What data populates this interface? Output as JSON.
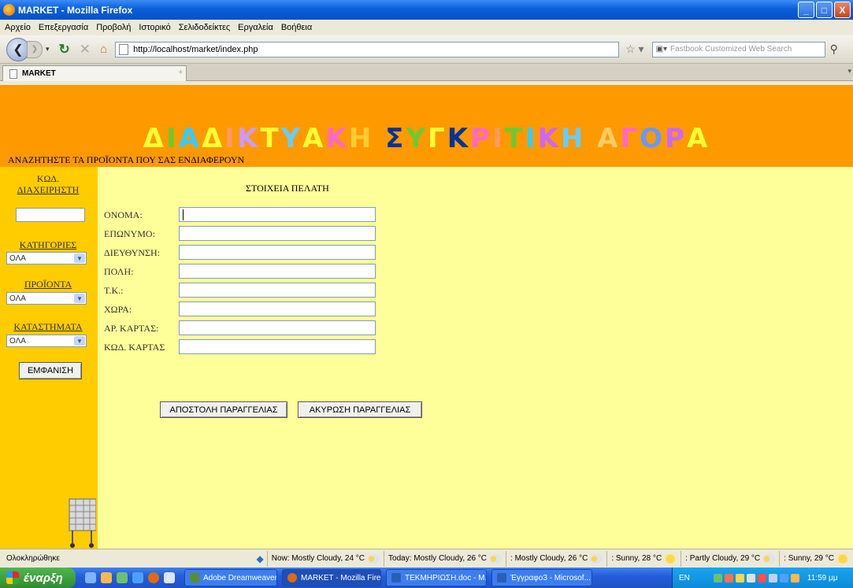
{
  "window": {
    "title": "MARKET - Mozilla Firefox",
    "controls": [
      "_",
      "□",
      "X"
    ]
  },
  "menu": [
    "Αρχείο",
    "Επεξεργασία",
    "Προβολή",
    "Ιστορικό",
    "Σελιδοδείκτες",
    "Εργαλεία",
    "Βοήθεια"
  ],
  "nav": {
    "url": "http://localhost/market/index.php",
    "search_placeholder": "Fastbook Customized Web Search"
  },
  "tab": {
    "label": "MARKET",
    "new_tab": "+"
  },
  "page": {
    "banner_letters": [
      {
        "ch": "Δ",
        "color": "#ffff33"
      },
      {
        "ch": "Ι",
        "color": "#66cc33"
      },
      {
        "ch": "Α",
        "color": "#33ccff"
      },
      {
        "ch": "Δ",
        "color": "#ffff33"
      },
      {
        "ch": "Ι",
        "color": "#ff9966"
      },
      {
        "ch": "Κ",
        "color": "#cc99ff"
      },
      {
        "ch": "Τ",
        "color": "#ffff33"
      },
      {
        "ch": "Υ",
        "color": "#66ccff"
      },
      {
        "ch": "Α",
        "color": "#ffff33"
      },
      {
        "ch": "Κ",
        "color": "#ff66cc"
      },
      {
        "ch": "Η",
        "color": "#ffcc33"
      },
      {
        "ch": " ",
        "color": "#ffffff"
      },
      {
        "ch": "Σ",
        "color": "#003399"
      },
      {
        "ch": "Υ",
        "color": "#66cc33"
      },
      {
        "ch": "Γ",
        "color": "#ffff33"
      },
      {
        "ch": "Κ",
        "color": "#003399"
      },
      {
        "ch": "Ρ",
        "color": "#ff66cc"
      },
      {
        "ch": "Ι",
        "color": "#ff9966"
      },
      {
        "ch": "Τ",
        "color": "#66cc33"
      },
      {
        "ch": "Ι",
        "color": "#33ccff"
      },
      {
        "ch": "Κ",
        "color": "#cc66ff"
      },
      {
        "ch": "Η",
        "color": "#66ccff"
      },
      {
        "ch": " ",
        "color": "#ffffff"
      },
      {
        "ch": "Α",
        "color": "#ffcc66"
      },
      {
        "ch": "Γ",
        "color": "#ff66cc"
      },
      {
        "ch": "Ο",
        "color": "#6699ff"
      },
      {
        "ch": "Ρ",
        "color": "#cc66ff"
      },
      {
        "ch": "Α",
        "color": "#ffff33"
      }
    ],
    "subheading": "ΑΝΑΖΗΤΗΣΤΕ ΤΑ ΠΡΟΪΟΝΤΑ ΠΟΥ ΣΑΣ ΕΝΔΙΑΦΕΡΟΥΝ",
    "sidebar": {
      "admin_code_label_1": "ΚΩΔ.",
      "admin_code_label_2": "ΔΙΑΧΕΙΡΗΣΤΗ",
      "categories_label": "ΚΑΤΗΓΟΡΙΕΣ",
      "categories_value": "ΟΛΑ",
      "products_label": "ΠΡΟΪΟΝΤΑ",
      "products_value": "ΟΛΑ",
      "stores_label": "ΚΑΤΑΣΤΗΜΑΤΑ",
      "stores_value": "ΟΛΑ",
      "show_button": "ΕΜΦΑΝΙΣΗ"
    },
    "form": {
      "title": "ΣΤΟΙΧΕΙΑ ΠΕΛΑΤΗ",
      "fields": [
        "ΟΝΟΜΑ:",
        "ΕΠΩΝΥΜΟ:",
        "ΔΙΕΥΘΥΝΣΗ:",
        "ΠΟΛΗ:",
        "Τ.Κ.:",
        "ΧΩΡΑ:",
        "ΑΡ. ΚΑΡΤΑΣ:",
        "ΚΩΔ. ΚΑΡΤΑΣ"
      ],
      "submit_button": "ΑΠΟΣΤΟΛΗ ΠΑΡΑΓΓΕΛΙΑΣ",
      "cancel_button": "ΑΚΥΡΩΣΗ ΠΑΡΑΓΓΕΛΙΑΣ"
    }
  },
  "status": {
    "text": "Ολοκληρώθηκε",
    "weather": [
      {
        "text": "Now: Mostly Cloudy, 24 °C",
        "icon": "cloud-sun-icon"
      },
      {
        "text": "Today: Mostly Cloudy, 26 °C",
        "icon": "cloud-sun-icon"
      },
      {
        "text": ": Mostly Cloudy, 26 °C",
        "icon": "cloud-sun-icon"
      },
      {
        "text": ": Sunny, 28 °C",
        "icon": "sun-icon"
      },
      {
        "text": ": Partly Cloudy, 29 °C",
        "icon": "cloud-sun-icon"
      },
      {
        "text": ": Sunny, 29 °C",
        "icon": "sun-icon"
      }
    ]
  },
  "taskbar": {
    "start": "έναρξη",
    "tasks": [
      {
        "label": "Adobe Dreamweaver ...",
        "color": "#5b8d2e"
      },
      {
        "label": "MARKET - Mozilla Fire...",
        "color": "#e06a10"
      },
      {
        "label": "ΤΕΚΜΗΡΙΩΣΗ.doc - M...",
        "color": "#2a5fb8"
      },
      {
        "label": "Έγγραφο3 - Microsof...",
        "color": "#2a5fb8"
      }
    ],
    "lang": "EN",
    "clock": "11:59 μμ"
  }
}
